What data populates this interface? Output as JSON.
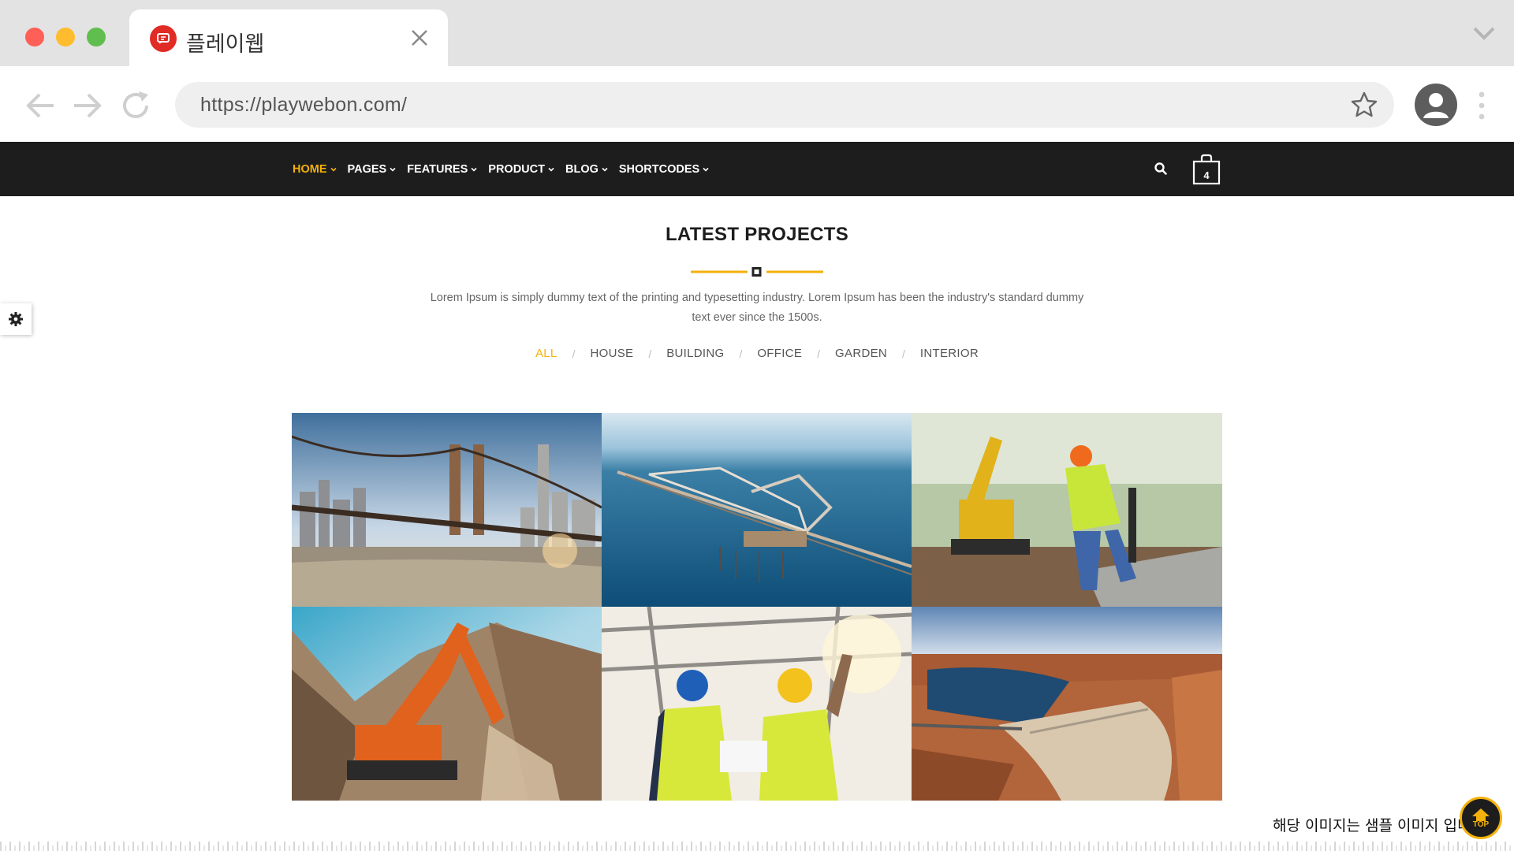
{
  "browser": {
    "tab_title": "플레이웹",
    "url": "https://playwebon.com/"
  },
  "nav": {
    "items": [
      {
        "label": "HOME",
        "active": true
      },
      {
        "label": "PAGES",
        "active": false
      },
      {
        "label": "FEATURES",
        "active": false
      },
      {
        "label": "PRODUCT",
        "active": false
      },
      {
        "label": "BLOG",
        "active": false
      },
      {
        "label": "SHORTCODES",
        "active": false
      }
    ],
    "cart_count": "4"
  },
  "section": {
    "title": "LATEST PROJECTS",
    "description": "Lorem Ipsum is simply dummy text of the printing and typesetting industry. Lorem Ipsum has been the industry's standard dummy text ever since the 1500s.",
    "filters": [
      {
        "label": "ALL",
        "active": true
      },
      {
        "label": "HOUSE",
        "active": false
      },
      {
        "label": "BUILDING",
        "active": false
      },
      {
        "label": "OFFICE",
        "active": false
      },
      {
        "label": "GARDEN",
        "active": false
      },
      {
        "label": "INTERIOR",
        "active": false
      }
    ],
    "filter_separator": "/"
  },
  "projects": [
    {
      "image": "bridge-city-photo"
    },
    {
      "image": "sea-pier-photo"
    },
    {
      "image": "construction-worker-photo"
    },
    {
      "image": "excavator-photo"
    },
    {
      "image": "engineers-photo"
    },
    {
      "image": "dam-photo"
    }
  ],
  "overlay": {
    "notice": "해당 이미지는 샘플 이미지 입니다",
    "top_label": "TOP"
  },
  "colors": {
    "accent": "#f5b10b",
    "nav_bg": "#1d1d1d",
    "favicon": "#e12b25"
  }
}
